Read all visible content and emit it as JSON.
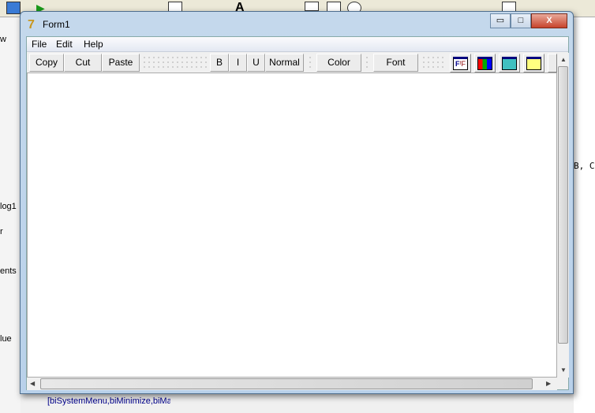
{
  "ide": {
    "left_labels": [
      "w",
      "log1",
      "r",
      "ents",
      "lue"
    ],
    "property_value": "[biSystemMenu,biMinimize,biMax",
    "code_fragment": "B, C"
  },
  "window": {
    "title": "Form1",
    "minimize": "▭",
    "maximize": "□",
    "close": "X"
  },
  "menu": [
    "File",
    "Edit",
    "Help"
  ],
  "toolbar": {
    "copy": "Copy",
    "cut": "Cut",
    "paste": "Paste",
    "bold": "B",
    "italic": "I",
    "underline": "U",
    "normal": "Normal",
    "color": "Color",
    "font": "Font"
  },
  "icons": [
    "font-style-icon",
    "color-palette-icon",
    "save-disk-icon",
    "open-folder-icon"
  ],
  "editor": {
    "content": ""
  }
}
